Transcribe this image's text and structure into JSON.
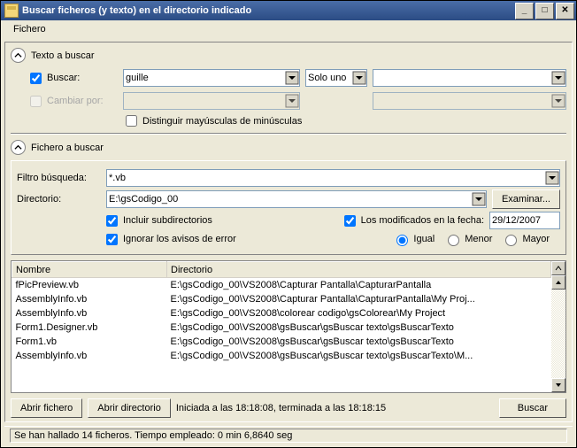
{
  "window": {
    "title": "Buscar ficheros (y texto) en el directorio indicado"
  },
  "menu": {
    "fichero": "Fichero"
  },
  "text_search": {
    "header": "Texto a buscar",
    "buscar_label": "Buscar:",
    "buscar_value": "guille",
    "solo_uno": "Solo uno",
    "cambiar_label": "Cambiar por:",
    "distinguir": "Distinguir mayúsculas de minúsculas"
  },
  "file_search": {
    "header": "Fichero a buscar",
    "filtro_label": "Filtro búsqueda:",
    "filtro_value": "*.vb",
    "dir_label": "Directorio:",
    "dir_value": "E:\\gsCodigo_00",
    "examinar": "Examinar...",
    "incluir_sub": "Incluir subdirectorios",
    "ignorar_err": "Ignorar los avisos de error",
    "mod_fecha": "Los modificados en la fecha:",
    "fecha_value": "29/12/2007",
    "r_igual": "Igual",
    "r_menor": "Menor",
    "r_mayor": "Mayor"
  },
  "table": {
    "col_nombre": "Nombre",
    "col_dir": "Directorio",
    "rows": [
      {
        "n": "fPicPreview.vb",
        "d": "E:\\gsCodigo_00\\VS2008\\Capturar Pantalla\\CapturarPantalla"
      },
      {
        "n": "AssemblyInfo.vb",
        "d": "E:\\gsCodigo_00\\VS2008\\Capturar Pantalla\\CapturarPantalla\\My Proj..."
      },
      {
        "n": "AssemblyInfo.vb",
        "d": "E:\\gsCodigo_00\\VS2008\\colorear codigo\\gsColorear\\My Project"
      },
      {
        "n": "Form1.Designer.vb",
        "d": "E:\\gsCodigo_00\\VS2008\\gsBuscar\\gsBuscar texto\\gsBuscarTexto"
      },
      {
        "n": "Form1.vb",
        "d": "E:\\gsCodigo_00\\VS2008\\gsBuscar\\gsBuscar texto\\gsBuscarTexto"
      },
      {
        "n": "AssemblyInfo.vb",
        "d": "E:\\gsCodigo_00\\VS2008\\gsBuscar\\gsBuscar texto\\gsBuscarTexto\\M..."
      }
    ]
  },
  "footer": {
    "abrir_fichero": "Abrir fichero",
    "abrir_dir": "Abrir directorio",
    "status_inline": "Iniciada a las 18:18:08, terminada a las 18:18:15",
    "buscar": "Buscar"
  },
  "statusbar": "Se han hallado 14 ficheros. Tiempo empleado: 0 min 6,8640 seg"
}
